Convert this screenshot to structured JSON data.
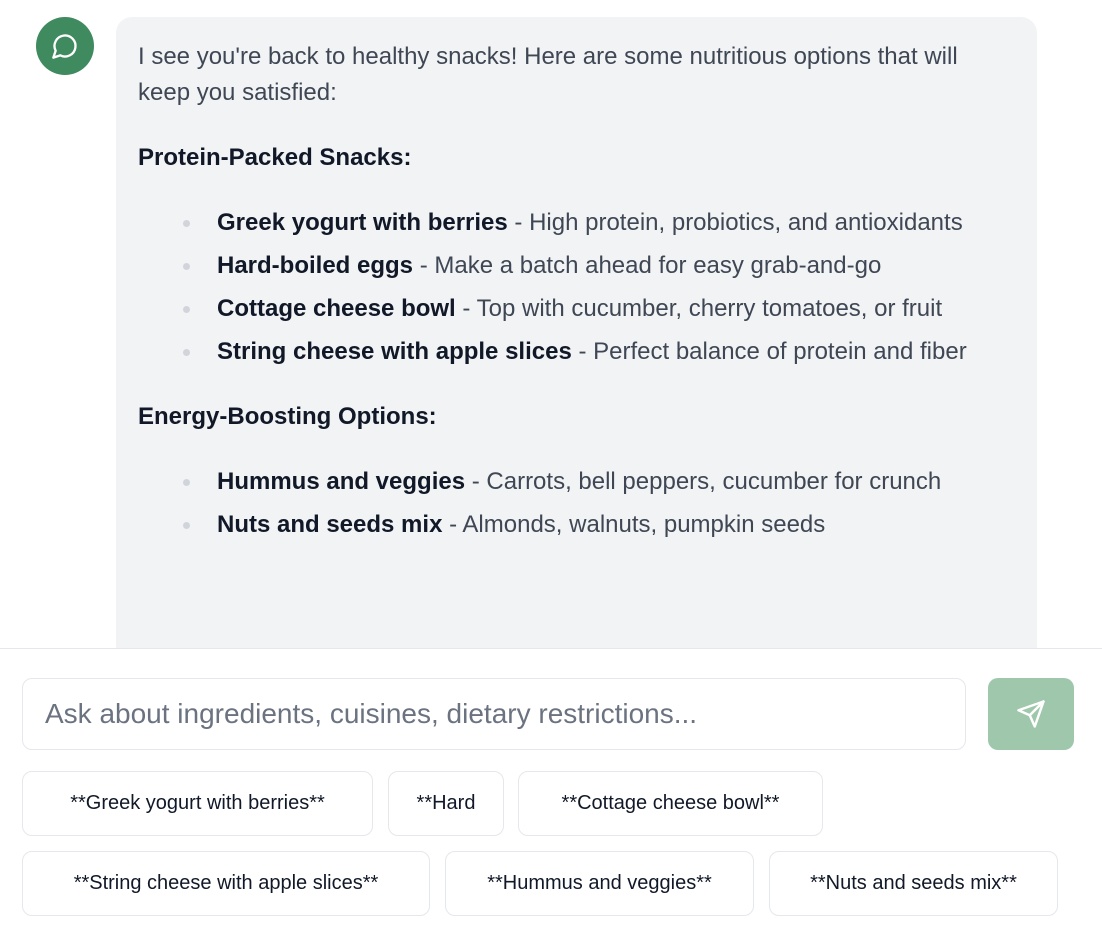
{
  "assistant": {
    "avatar_icon": "chat-bubble-icon",
    "accent_color": "#3f8a5f",
    "intro": "I see you're back to healthy snacks! Here are some nutritious options that will keep you satisfied:",
    "sections": [
      {
        "title": "Protein-Packed Snacks:",
        "items": [
          {
            "name": "Greek yogurt with berries",
            "desc": " - High protein, probiotics, and antioxidants"
          },
          {
            "name": "Hard-boiled eggs",
            "desc": " - Make a batch ahead for easy grab-and-go"
          },
          {
            "name": "Cottage cheese bowl",
            "desc": " - Top with cucumber, cherry tomatoes, or fruit"
          },
          {
            "name": "String cheese with apple slices",
            "desc": " - Perfect balance of protein and fiber"
          }
        ]
      },
      {
        "title": "Energy-Boosting Options:",
        "items": [
          {
            "name": "Hummus and veggies",
            "desc": " - Carrots, bell peppers, cucumber for crunch"
          },
          {
            "name": "Nuts and seeds mix",
            "desc": " - Almonds, walnuts, pumpkin seeds"
          }
        ]
      }
    ]
  },
  "composer": {
    "placeholder": "Ask about ingredients, cuisines, dietary restrictions...",
    "send_icon": "paper-plane-icon",
    "send_color": "#9ec7ab"
  },
  "suggestions": [
    "**Greek yogurt with berries**",
    "**Hard",
    "**Cottage cheese bowl**",
    "**String cheese with apple slices**",
    "**Hummus and veggies**",
    "**Nuts and seeds mix**"
  ]
}
